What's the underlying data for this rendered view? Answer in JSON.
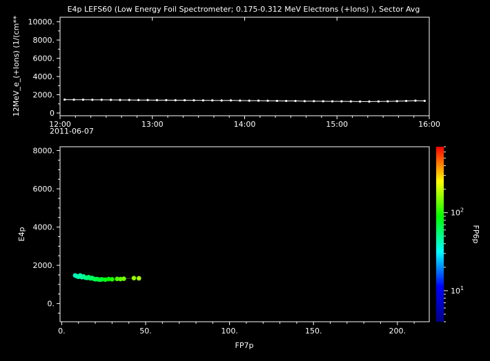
{
  "title": "E4p LEFS60 (Low Energy Foil Spectrometer; 0.175-0.312 MeV Electrons (+Ions) ), Sector Avg",
  "chart_data": [
    {
      "type": "line",
      "ylabel": "12MeV_e_(+Ions) (1/(cm**",
      "xlabel": "",
      "date_label": "2011-06-07",
      "x_ticks": [
        "12:00",
        "13:00",
        "14:00",
        "15:00",
        "16:00"
      ],
      "y_ticks": [
        "0",
        "2000.",
        "4000.",
        "6000.",
        "8000.",
        "10000."
      ],
      "xlim": [
        "12:00",
        "16:00"
      ],
      "ylim": [
        -300,
        10500
      ],
      "grid": false,
      "series": [
        {
          "x": [
            "12:03",
            "12:09",
            "12:15",
            "12:21",
            "12:27",
            "12:33",
            "12:39",
            "12:45",
            "12:51",
            "12:57",
            "13:03",
            "13:09",
            "13:15",
            "13:21",
            "13:27",
            "13:33",
            "13:39",
            "13:45",
            "13:51",
            "13:57",
            "14:03",
            "14:09",
            "14:15",
            "14:21",
            "14:27",
            "14:33",
            "14:39",
            "14:45",
            "14:51",
            "14:57",
            "15:03",
            "15:09",
            "15:15",
            "15:21",
            "15:27",
            "15:33",
            "15:39",
            "15:45",
            "15:51",
            "15:57"
          ],
          "values": [
            1470,
            1460,
            1460,
            1450,
            1450,
            1440,
            1430,
            1430,
            1420,
            1420,
            1410,
            1410,
            1400,
            1400,
            1390,
            1380,
            1380,
            1370,
            1380,
            1360,
            1350,
            1350,
            1340,
            1330,
            1320,
            1320,
            1300,
            1300,
            1290,
            1280,
            1280,
            1270,
            1260,
            1260,
            1270,
            1280,
            1300,
            1320,
            1350,
            1330
          ]
        }
      ]
    },
    {
      "type": "scatter",
      "xlabel": "FP7p",
      "ylabel": "E4p",
      "colorbar_label": "FP6p",
      "x_ticks": [
        "0.",
        "50.",
        "100.",
        "150.",
        "200."
      ],
      "y_ticks": [
        "0.",
        "2000.",
        "4000.",
        "6000.",
        "8000."
      ],
      "xlim": [
        -1,
        219
      ],
      "ylim": [
        -950,
        8200
      ],
      "colorbar": {
        "scale": "log",
        "range": [
          4,
          700
        ],
        "ticks": [
          "10^1",
          "10^2"
        ],
        "colors": [
          "#00008b",
          "#0000ff",
          "#00ffff",
          "#00ff00",
          "#ffff00",
          "#ff0000"
        ]
      },
      "grid": false,
      "points": [
        {
          "x": 8,
          "y": 1470,
          "c": 40
        },
        {
          "x": 9,
          "y": 1430,
          "c": 42
        },
        {
          "x": 10,
          "y": 1400,
          "c": 45
        },
        {
          "x": 11,
          "y": 1470,
          "c": 44
        },
        {
          "x": 12,
          "y": 1380,
          "c": 46
        },
        {
          "x": 13,
          "y": 1420,
          "c": 48
        },
        {
          "x": 14,
          "y": 1360,
          "c": 50
        },
        {
          "x": 15,
          "y": 1340,
          "c": 52
        },
        {
          "x": 16,
          "y": 1380,
          "c": 55
        },
        {
          "x": 17,
          "y": 1320,
          "c": 58
        },
        {
          "x": 18,
          "y": 1340,
          "c": 60
        },
        {
          "x": 19,
          "y": 1300,
          "c": 62
        },
        {
          "x": 20,
          "y": 1270,
          "c": 64
        },
        {
          "x": 21,
          "y": 1280,
          "c": 66
        },
        {
          "x": 22,
          "y": 1260,
          "c": 68
        },
        {
          "x": 23,
          "y": 1250,
          "c": 70
        },
        {
          "x": 24,
          "y": 1270,
          "c": 75
        },
        {
          "x": 26,
          "y": 1250,
          "c": 80
        },
        {
          "x": 28,
          "y": 1280,
          "c": 90
        },
        {
          "x": 30,
          "y": 1270,
          "c": 100
        },
        {
          "x": 33,
          "y": 1290,
          "c": 120
        },
        {
          "x": 35,
          "y": 1280,
          "c": 130
        },
        {
          "x": 37,
          "y": 1300,
          "c": 140
        },
        {
          "x": 43,
          "y": 1330,
          "c": 160
        },
        {
          "x": 46,
          "y": 1320,
          "c": 175
        }
      ]
    }
  ]
}
